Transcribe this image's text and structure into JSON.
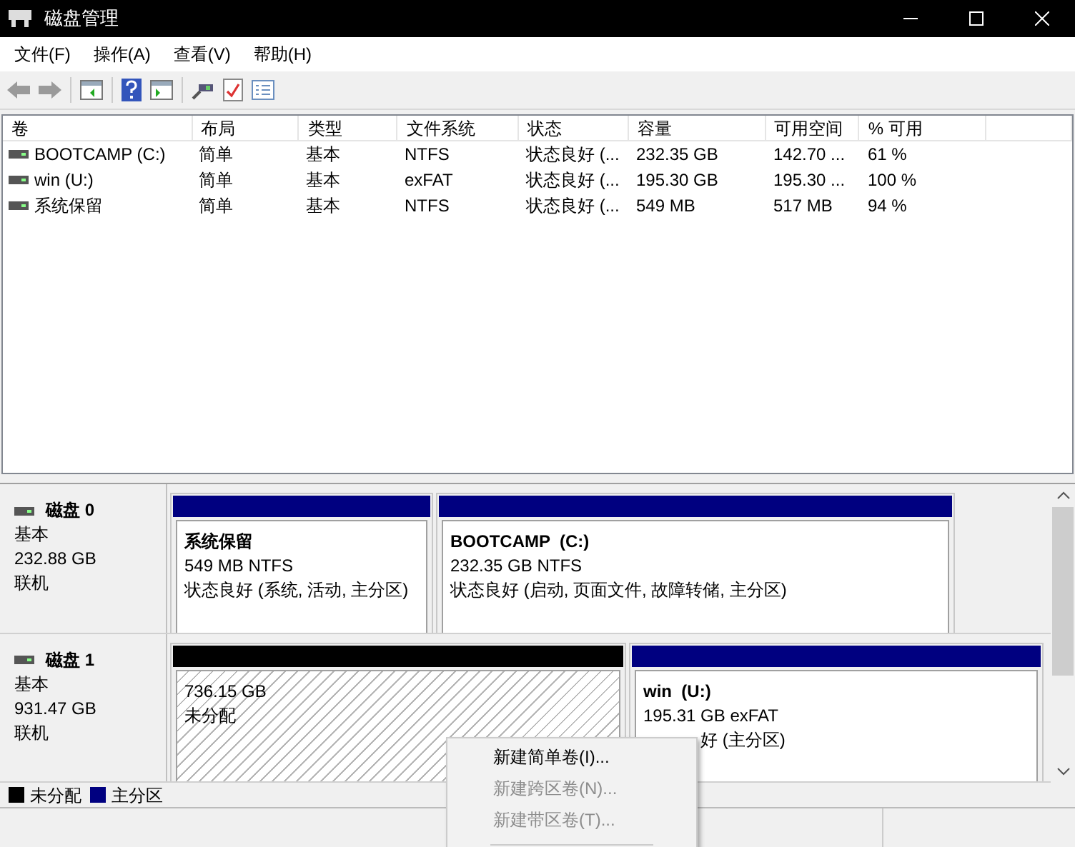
{
  "window": {
    "title": "磁盘管理"
  },
  "menu": [
    "文件(F)",
    "操作(A)",
    "查看(V)",
    "帮助(H)"
  ],
  "table": {
    "columns": [
      "卷",
      "布局",
      "类型",
      "文件系统",
      "状态",
      "容量",
      "可用空间",
      "% 可用"
    ],
    "rows": [
      {
        "cells": [
          "BOOTCAMP (C:)",
          "简单",
          "基本",
          "NTFS",
          "状态良好 (...",
          "232.35 GB",
          "142.70 ...",
          "61 %"
        ]
      },
      {
        "cells": [
          "win (U:)",
          "简单",
          "基本",
          "exFAT",
          "状态良好 (...",
          "195.30 GB",
          "195.30 ...",
          "100 %"
        ]
      },
      {
        "cells": [
          "系统保留",
          "简单",
          "基本",
          "NTFS",
          "状态良好 (...",
          "549 MB",
          "517 MB",
          "94 %"
        ]
      }
    ]
  },
  "disks": [
    {
      "name": "磁盘 0",
      "type": "基本",
      "size": "232.88 GB",
      "status": "联机",
      "partitions": [
        {
          "kind": "primary",
          "name": "系统保留",
          "size_fs": "549 MB NTFS",
          "status": "状态良好 (系统, 活动, 主分区)"
        },
        {
          "kind": "primary",
          "name": "BOOTCAMP  (C:)",
          "size_fs": "232.35 GB NTFS",
          "status": "状态良好 (启动, 页面文件, 故障转储, 主分区)"
        }
      ]
    },
    {
      "name": "磁盘 1",
      "type": "基本",
      "size": "931.47 GB",
      "status": "联机",
      "partitions": [
        {
          "kind": "unallocated",
          "size_fs": "736.15 GB",
          "status": "未分配"
        },
        {
          "kind": "primary",
          "name": "win  (U:)",
          "size_fs": "195.31 GB exFAT",
          "status": "好 (主分区)"
        }
      ]
    }
  ],
  "legend": [
    {
      "label": "未分配",
      "color": "#000000"
    },
    {
      "label": "主分区",
      "color": "#000080"
    }
  ],
  "context_menu": [
    {
      "label": "新建简单卷(I)...",
      "disabled": false
    },
    {
      "label": "新建跨区卷(N)...",
      "disabled": true
    },
    {
      "label": "新建带区卷(T)...",
      "disabled": true
    }
  ]
}
